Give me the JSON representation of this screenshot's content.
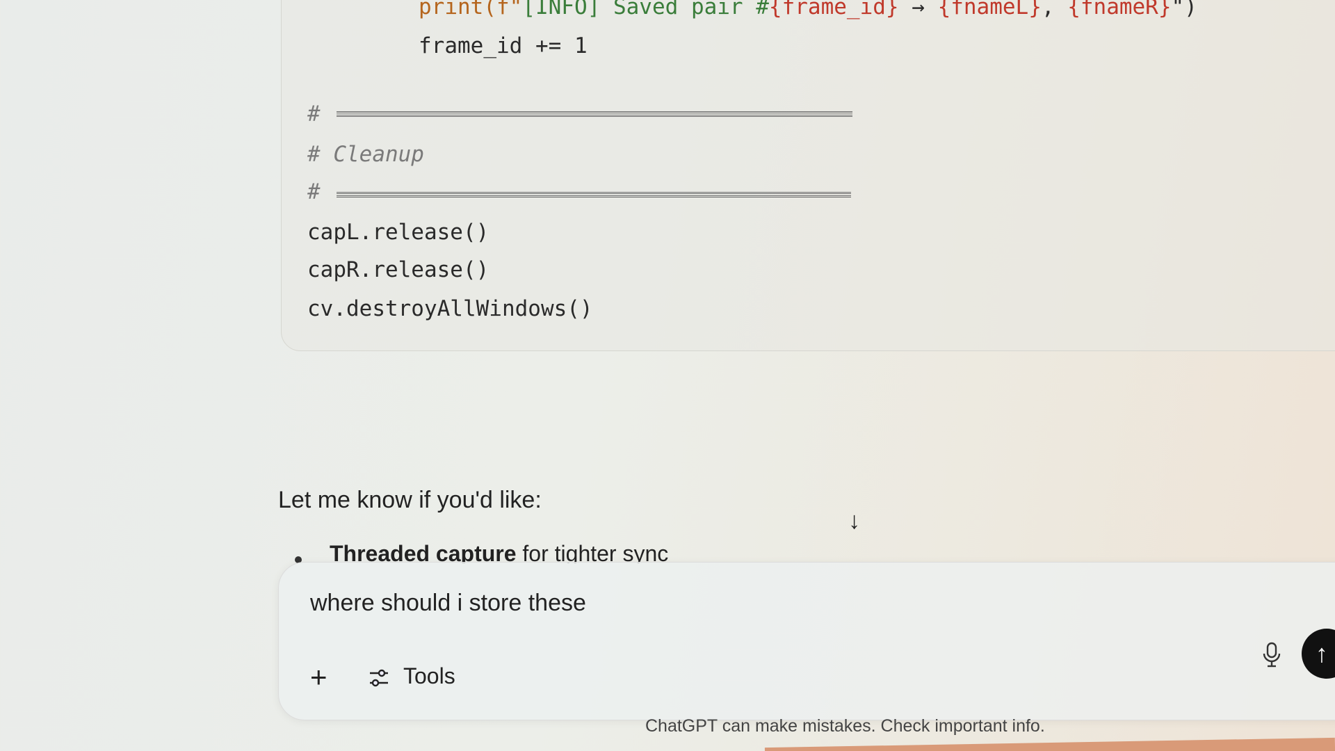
{
  "code": {
    "line_print_fn": "print(",
    "line_print_fpre": "f\"",
    "line_print_str": "[INFO] Saved pair #",
    "line_print_var1": "{frame_id}",
    "line_print_arrow": " → ",
    "line_print_var2": "{fnameL}",
    "line_print_sep": ", ",
    "line_print_var3": "{fnameR}",
    "line_print_end": "\")",
    "line_increment": "frame_id += 1",
    "comment_hash": "#",
    "comment_cleanup": "# Cleanup",
    "line_capL": "capL.release()",
    "line_capR": "capR.release()",
    "line_destroy": "cv.destroyAllWindows()"
  },
  "message": {
    "intro": "Let me know if you'd like:",
    "bullet_bold": "Threaded capture",
    "bullet_rest": " for tighter sync"
  },
  "composer": {
    "text": "where should i store these",
    "plus": "+",
    "tools_label": "Tools",
    "send": "↑",
    "scroll_down": "↓"
  },
  "footer": "ChatGPT can make mistakes. Check important info."
}
